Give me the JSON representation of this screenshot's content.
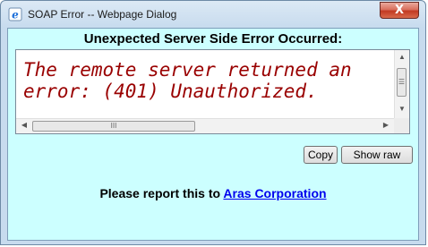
{
  "window": {
    "title": "SOAP Error -- Webpage Dialog",
    "close_label": "X"
  },
  "dialog": {
    "header": "Unexpected Server Side Error Occurred:",
    "message": "The remote server returned an error: (401) Unauthorized.",
    "copy_label": "Copy",
    "show_raw_label": "Show raw",
    "report_prefix": "Please report this to ",
    "report_link": "Aras Corporation"
  },
  "scrollbars": {
    "up_arrow": "▲",
    "down_arrow": "▼",
    "left_arrow": "◀",
    "right_arrow": "▶",
    "v_grip": "☰",
    "h_grip": "III"
  },
  "colors": {
    "client_background": "#ccffff",
    "message_text": "#990000",
    "link": "#0000ee"
  },
  "icons": {
    "title": "ie-page-icon",
    "close": "close-icon"
  }
}
